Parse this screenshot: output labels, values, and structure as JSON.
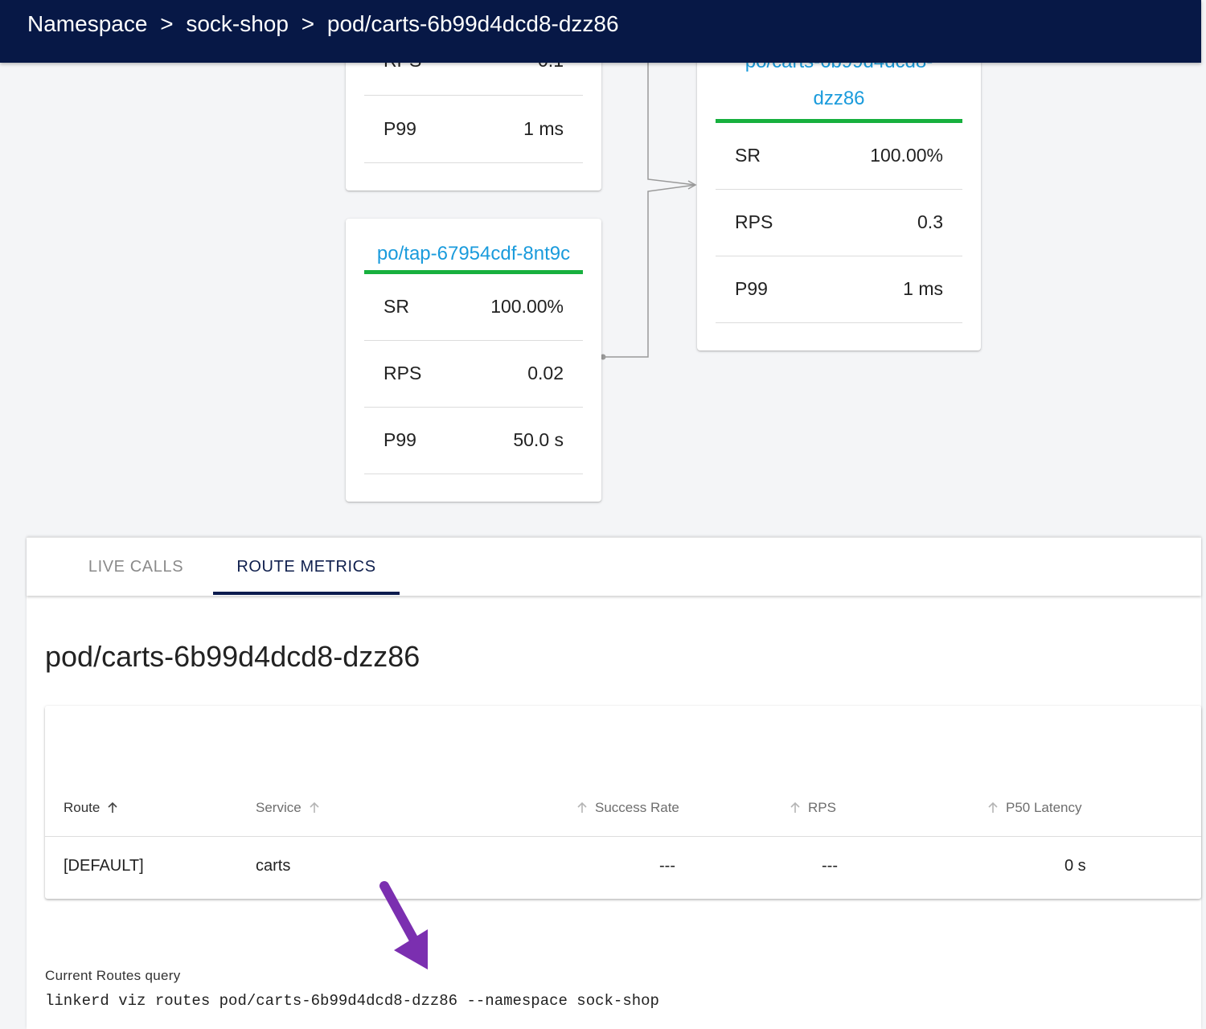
{
  "breadcrumb": {
    "namespace_label": "Namespace",
    "separator": ">",
    "namespace": "sock-shop",
    "resource": "pod/carts-6b99d4dcd8-dzz86"
  },
  "graph": {
    "node_upper_left": {
      "title": "",
      "rows": [
        {
          "label": "RPS",
          "value": "0.1"
        },
        {
          "label": "P99",
          "value": "1 ms"
        }
      ]
    },
    "node_tap": {
      "title": "po/tap-67954cdf-8nt9c",
      "rows": [
        {
          "label": "SR",
          "value": "100.00%"
        },
        {
          "label": "RPS",
          "value": "0.02"
        },
        {
          "label": "P99",
          "value": "50.0 s"
        }
      ]
    },
    "node_carts": {
      "title_line1": "po/carts-6b99d4dcd8-",
      "title_line2": "dzz86",
      "rows": [
        {
          "label": "SR",
          "value": "100.00%"
        },
        {
          "label": "RPS",
          "value": "0.3"
        },
        {
          "label": "P99",
          "value": "1 ms"
        }
      ]
    },
    "colors": {
      "title": "#1a9bdc",
      "success_bar": "#17b03e"
    }
  },
  "tabs": [
    {
      "label": "LIVE CALLS",
      "active": false
    },
    {
      "label": "ROUTE METRICS",
      "active": true
    }
  ],
  "route_metrics": {
    "title": "pod/carts-6b99d4dcd8-dzz86",
    "columns": {
      "route": "Route",
      "service": "Service",
      "success_rate": "Success Rate",
      "rps": "RPS",
      "p50": "P50 Latency"
    },
    "rows": [
      {
        "route": "[DEFAULT]",
        "service": "carts",
        "success_rate": "---",
        "rps": "---",
        "p50": "0 s"
      }
    ],
    "query_label": "Current Routes query",
    "query": "linkerd viz routes pod/carts-6b99d4dcd8-dzz86 --namespace sock-shop"
  },
  "colors": {
    "topbar": "#071846",
    "tab_active": "#0b1b4e",
    "annotation_arrow": "#7b2fb0"
  },
  "icons": {
    "sort": "arrow-up-icon",
    "annotation": "pointer-arrow-icon"
  }
}
